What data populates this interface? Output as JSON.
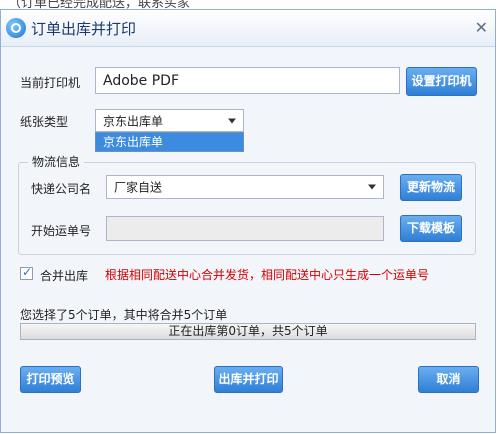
{
  "window": {
    "title": "订单出库并打印",
    "close_symbol": "✕",
    "icon": "app-logo-icon"
  },
  "printer": {
    "label": "当前打印机",
    "value": "Adobe PDF",
    "button": "设置打印机"
  },
  "paper": {
    "label": "纸张类型",
    "value": "京东出库单",
    "options": [
      "京东出库单"
    ]
  },
  "logistics": {
    "group_title": "物流信息",
    "company_label": "快递公司名",
    "company_value": "厂家自送",
    "refresh_button": "更新物流",
    "tracking_label": "开始运单号",
    "tracking_value": "",
    "download_button": "下载模板"
  },
  "merge": {
    "checked": true,
    "label": "合并出库",
    "hint": "根据相同配送中心合并发货，相同配送中心只生成一个运单号"
  },
  "summary": {
    "text": "您选择了5个订单，其中将合并5个订单"
  },
  "progress": {
    "text": "正在出库第0订单，共5个订单",
    "fraction": 0
  },
  "actions": {
    "preview": "打印预览",
    "ship_print": "出库并打印",
    "cancel": "取消"
  },
  "colors": {
    "button": "#2f7fd6",
    "hint_red": "#d40000",
    "dropdown_highlight": "#3b8be0"
  }
}
